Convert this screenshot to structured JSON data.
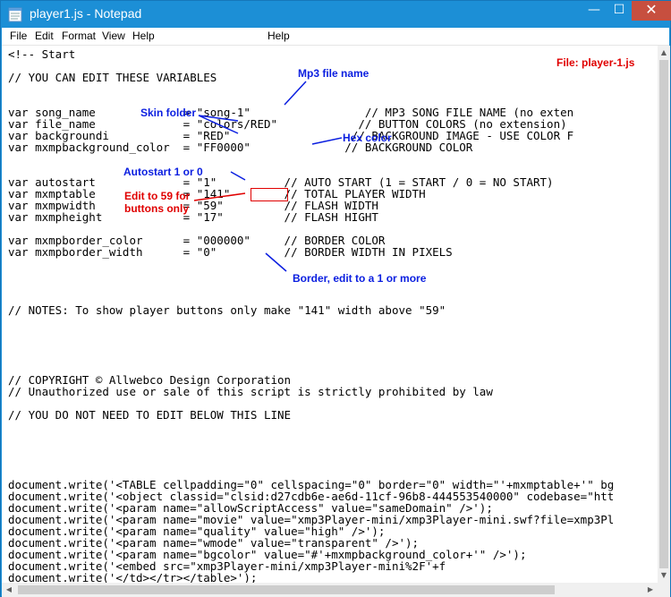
{
  "window": {
    "title": "player1.js - Notepad",
    "icon": "notepad-icon",
    "controls": {
      "minimize": "—",
      "maximize": "☐",
      "close": "✕"
    }
  },
  "menu": {
    "items": [
      "File",
      "Edit",
      "Format",
      "View",
      "Help"
    ],
    "extra": "Help"
  },
  "code": {
    "lines": [
      "<!-- Start",
      "",
      "// YOU CAN EDIT THESE VARIABLES",
      "",
      "",
      "var song_name             = \"song-1\"                 // MP3 SONG FILE NAME (no exten",
      "var file_name             = \"colors/RED\"            // BUTTON COLORS (no extension)",
      "var backgroundi           = \"RED\"                  // BACKGROUND IMAGE - USE COLOR F",
      "var mxmpbackground_color  = \"FF0000\"              // BACKGROUND COLOR",
      "",
      "",
      "var autostart             = \"1\"          // AUTO START (1 = START / 0 = NO START)",
      "var mxmptable             = \"141\"        // TOTAL PLAYER WIDTH",
      "var mxmpwidth             = \"59\"         // FLASH WIDTH",
      "var mxmpheight            = \"17\"         // FLASH HIGHT",
      "",
      "var mxmpborder_color      = \"000000\"     // BORDER COLOR",
      "var mxmpborder_width      = \"0\"          // BORDER WIDTH IN PIXELS",
      "",
      "",
      "",
      "",
      "// NOTES: To show player buttons only make \"141\" width above \"59\"",
      "",
      "",
      "",
      "",
      "",
      "// COPYRIGHT © Allwebco Design Corporation",
      "// Unauthorized use or sale of this script is strictly prohibited by law",
      "",
      "// YOU DO NOT NEED TO EDIT BELOW THIS LINE",
      "",
      "",
      "",
      "",
      "",
      "document.write('<TABLE cellpadding=\"0\" cellspacing=\"0\" border=\"0\" width=\"'+mxmptable+'\" bg",
      "document.write('<object classid=\"clsid:d27cdb6e-ae6d-11cf-96b8-444553540000\" codebase=\"htt",
      "document.write('<param name=\"allowScriptAccess\" value=\"sameDomain\" />');",
      "document.write('<param name=\"movie\" value=\"xmp3Player-mini/xmp3Player-mini.swf?file=xmp3Pl",
      "document.write('<param name=\"quality\" value=\"high\" />');",
      "document.write('<param name=\"wmode\" value=\"transparent\" />');",
      "document.write('<param name=\"bgcolor\" value=\"#'+mxmpbackground_color+'\" />');",
      "document.write('<embed src=\"xmp3Player-mini/xmp3Player-mini%2F'+f",
      "document.write('</td></tr></table>');"
    ]
  },
  "annotations": {
    "mp3_file_name": "Mp3 file name",
    "file_label": "File: player-1.js",
    "skin_folder": "Skin folder",
    "hex_color": "Hex color",
    "autostart": "Autostart 1 or 0",
    "edit_59": "Edit to 59 for\nbuttons only",
    "border": "Border, edit to a 1 or more"
  },
  "colors": {
    "titlebar": "#1c8fd6",
    "close": "#c74f3f",
    "annotation_blue": "#0a1ee0",
    "annotation_red": "#e00000"
  }
}
